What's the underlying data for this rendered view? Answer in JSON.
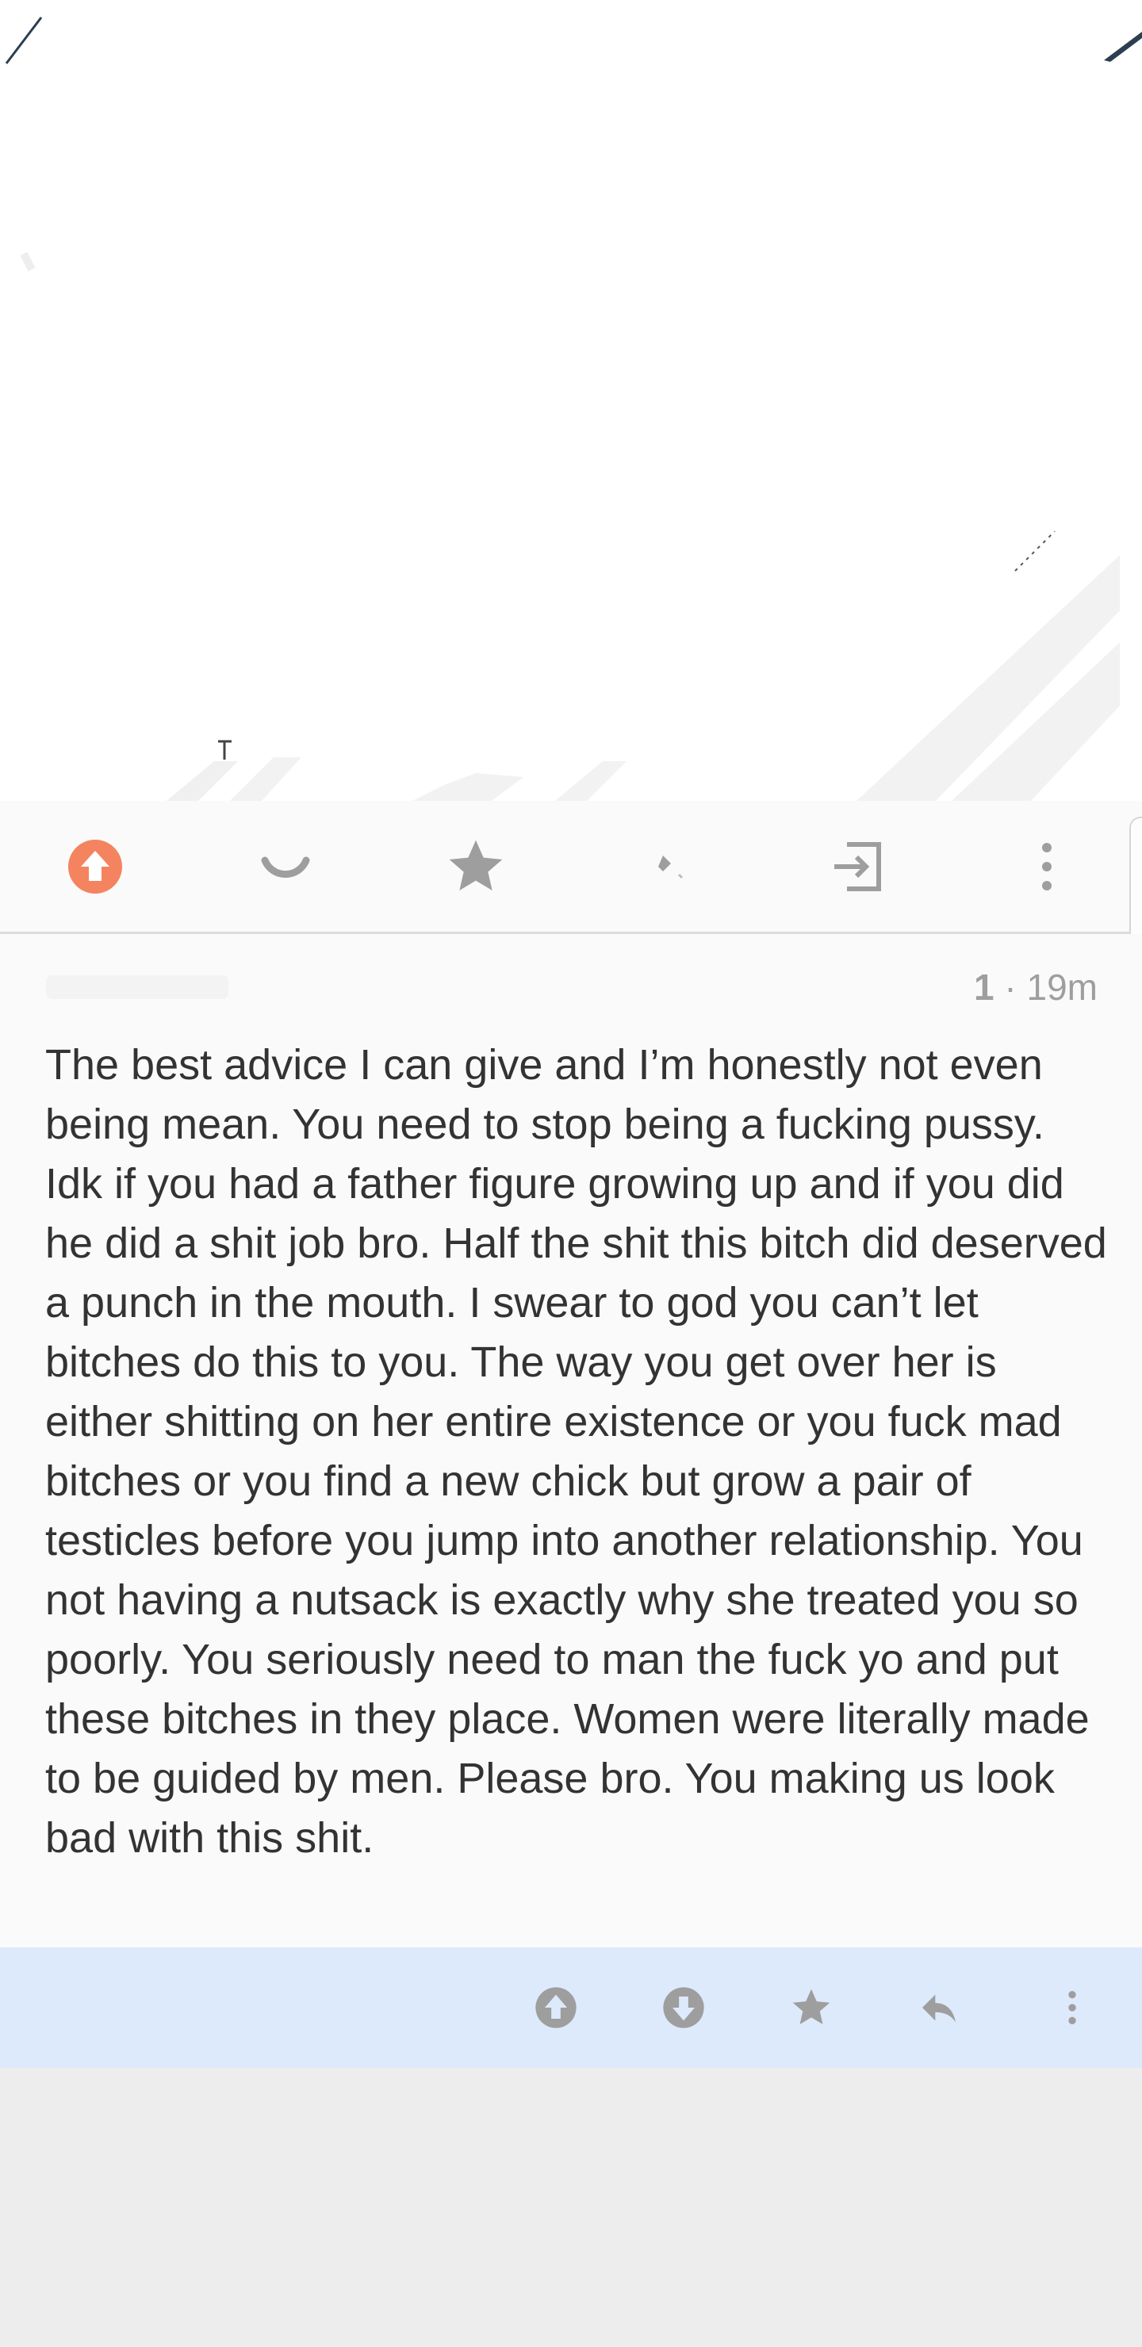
{
  "post_toolbar": {
    "items": [
      {
        "name": "upvote",
        "icon": "upvote-icon",
        "active": true,
        "color": "#f4845f"
      },
      {
        "name": "downvote",
        "icon": "downvote-icon",
        "active": false
      },
      {
        "name": "save",
        "icon": "star-icon",
        "active": false
      },
      {
        "name": "hide",
        "icon": "hide-icon",
        "active": false
      },
      {
        "name": "open",
        "icon": "open-external-icon",
        "active": false
      },
      {
        "name": "more",
        "icon": "more-vert-icon",
        "active": false
      }
    ]
  },
  "comment": {
    "score": "1",
    "separator": " · ",
    "age": "19m",
    "body": "The best advice I can give and I’m honestly not even being mean. You need to stop being a fucking pussy. Idk if you had a father figure growing up and if you did he did a shit job bro. Half the shit this bitch did deserved a punch in the mouth. I swear to god you can’t let bitches do this to you. The way you get over her is either shitting on her entire existence or you fuck mad bitches or you find a new chick but grow a pair of testicles before you jump into another relationship. You not having a nutsack is exactly why she treated you so poorly. You seriously need to man the fuck yo and put these bitches in they place. Women were literally made to be guided by men. Please bro. You making us look bad with this shit.",
    "actions": [
      {
        "name": "upvote",
        "icon": "upvote-circle-icon"
      },
      {
        "name": "downvote",
        "icon": "downvote-circle-icon"
      },
      {
        "name": "save",
        "icon": "star-icon"
      },
      {
        "name": "reply",
        "icon": "reply-icon"
      },
      {
        "name": "more",
        "icon": "more-vert-icon"
      }
    ]
  },
  "colors": {
    "accent_upvote": "#f4845f",
    "icon_gray": "#9e9e9e",
    "comment_actions_bg": "#ddeafc",
    "page_bg": "#ededed"
  }
}
